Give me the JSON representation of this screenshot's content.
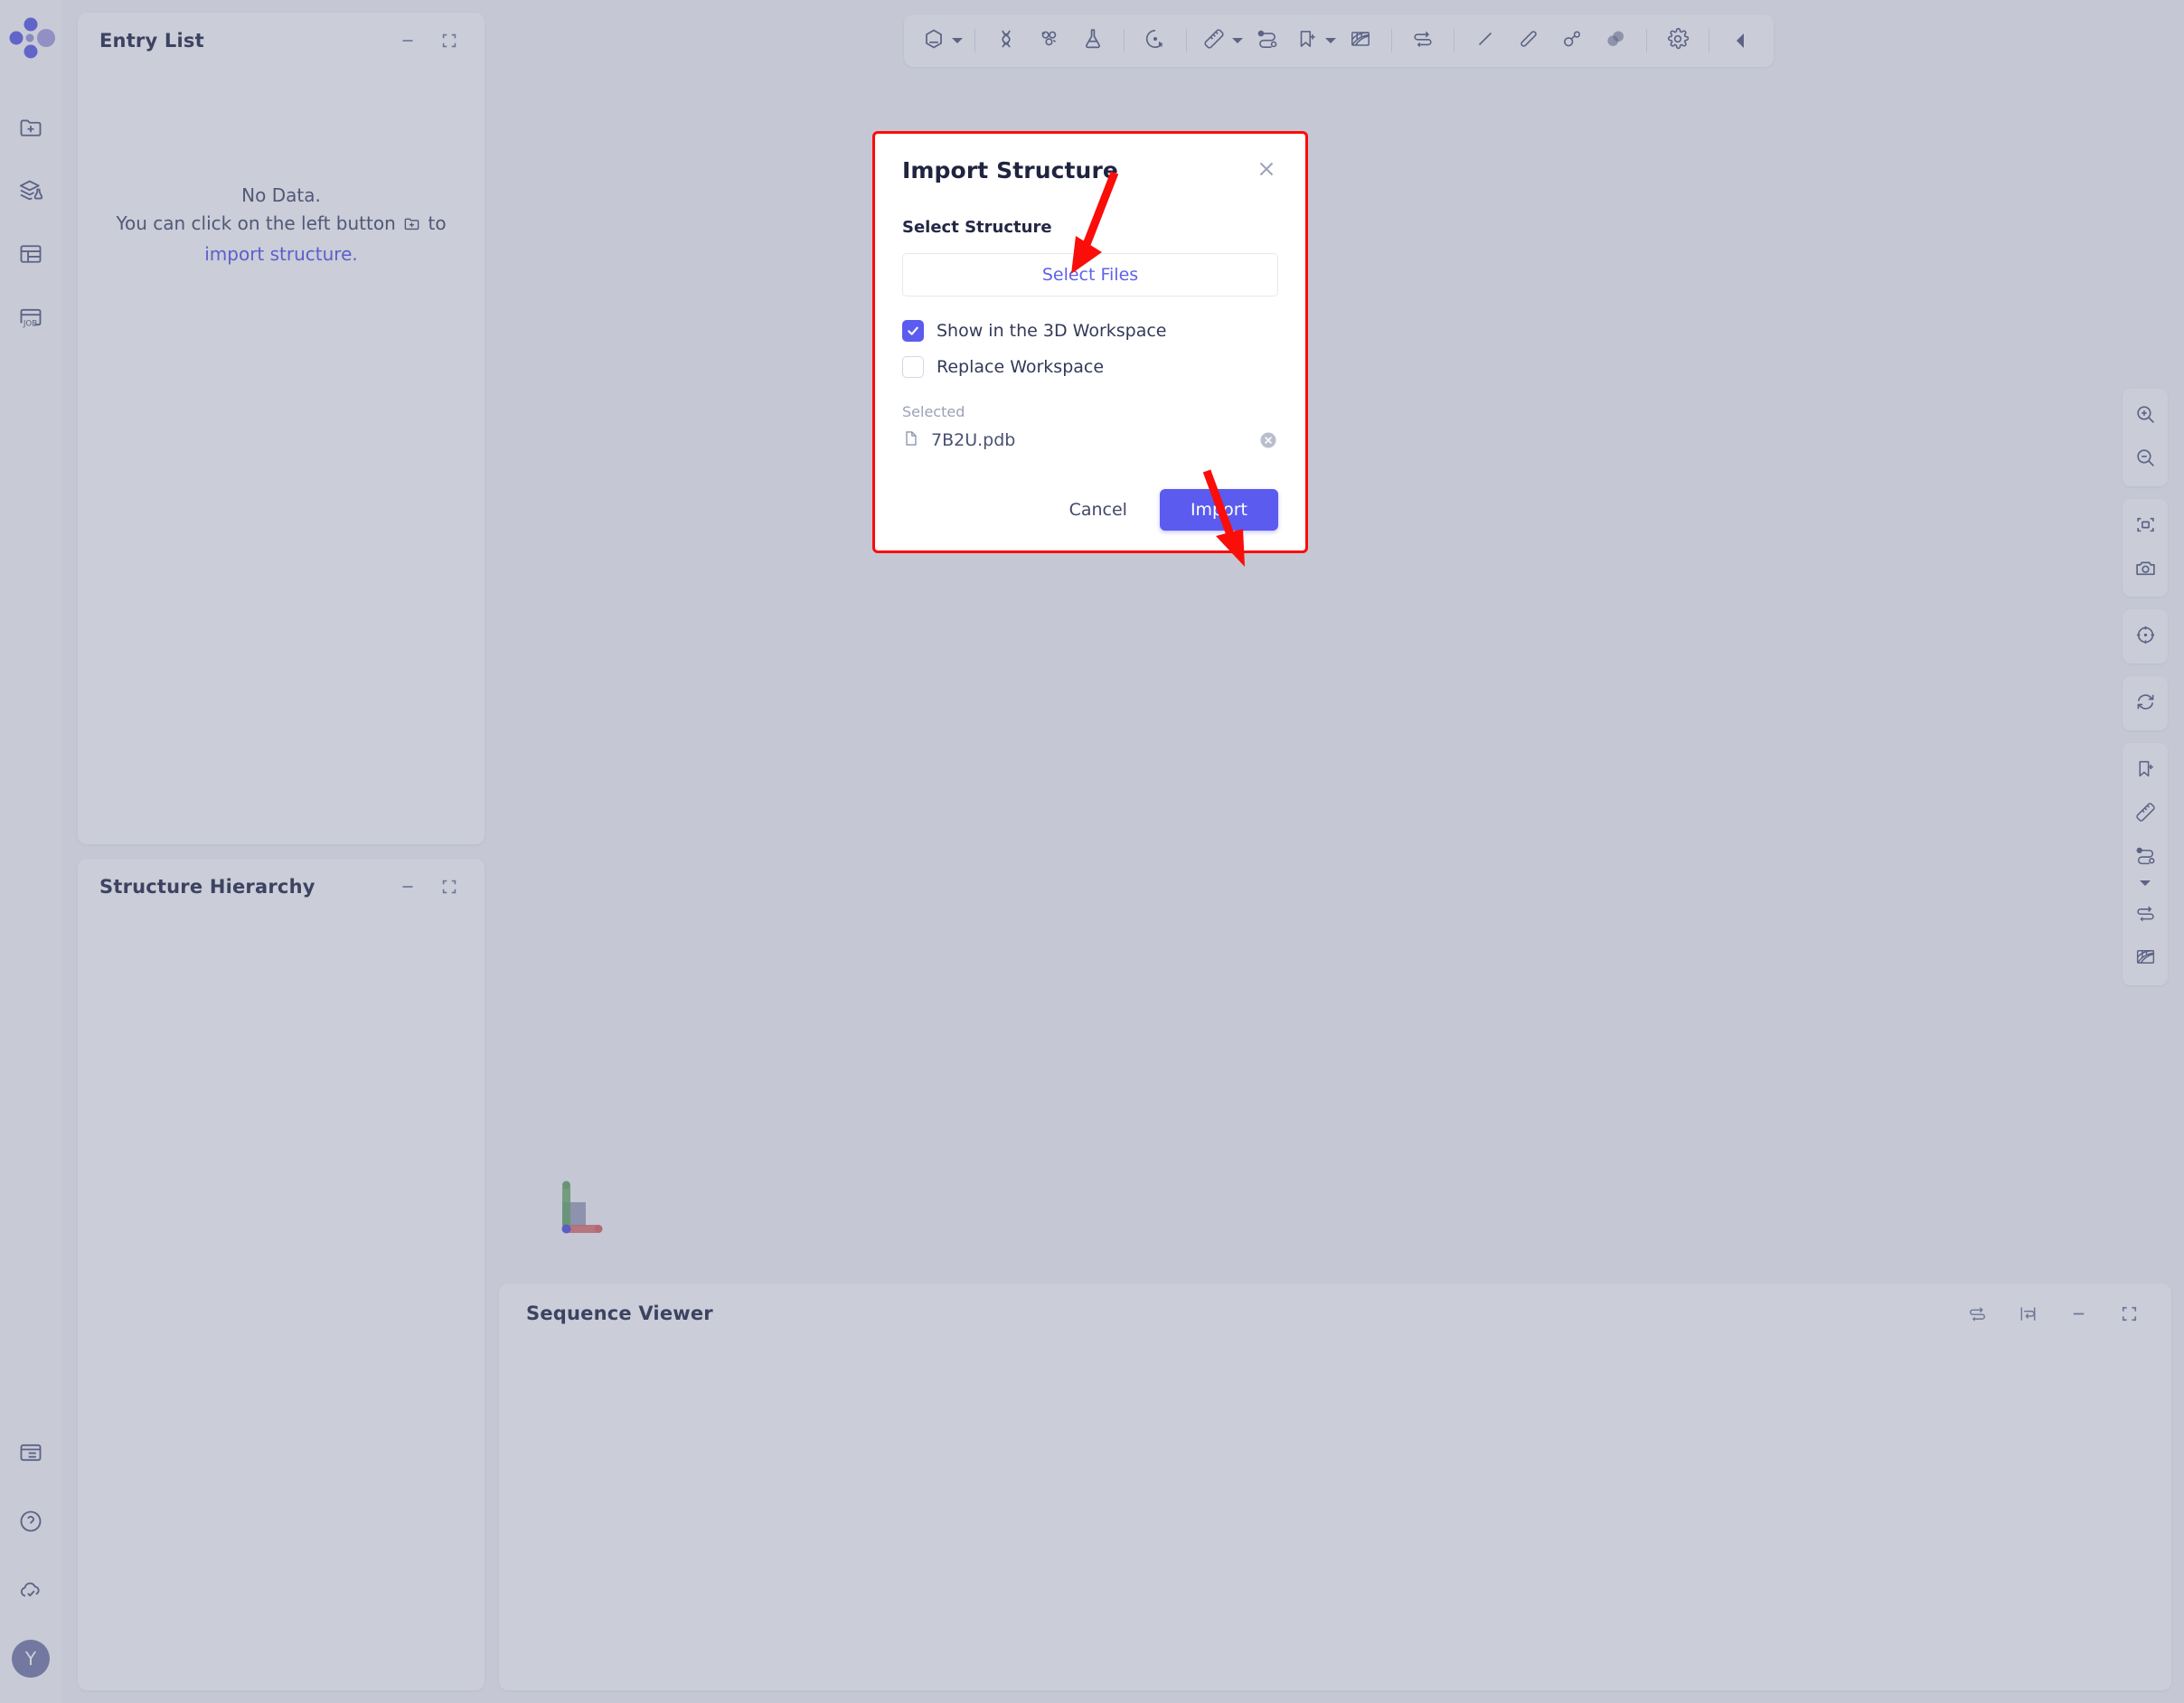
{
  "app": {
    "logo_icon": "molecule-dots-logo",
    "avatar_initial": "Y"
  },
  "rail": {
    "top_items": [
      {
        "name": "import-structure",
        "icon": "folder-plus-icon"
      },
      {
        "name": "structure-library",
        "icon": "layers-flask-icon"
      },
      {
        "name": "table-view",
        "icon": "table-layout-icon"
      },
      {
        "name": "jobs",
        "icon": "job-card-icon"
      }
    ],
    "bottom_items": [
      {
        "name": "log-panel",
        "icon": "list-window-icon"
      },
      {
        "name": "help",
        "icon": "question-circle-icon"
      },
      {
        "name": "cloud-sync",
        "icon": "cloud-check-icon"
      }
    ]
  },
  "panels": {
    "entry_list": {
      "title": "Entry List",
      "empty_line1": "No Data.",
      "empty_line2_pre": "You can click on the left button",
      "empty_line2_post": "to",
      "empty_link": "import structure.",
      "minimize_icon": "minimize-icon",
      "expand_icon": "expand-icon"
    },
    "structure_hierarchy": {
      "title": "Structure Hierarchy",
      "minimize_icon": "minimize-icon",
      "expand_icon": "expand-icon"
    },
    "sequence_viewer": {
      "title": "Sequence Viewer",
      "actions": [
        {
          "name": "toggle-chain-swap",
          "icon": "swap-arrows-icon"
        },
        {
          "name": "wrap-lines",
          "icon": "wrap-text-icon"
        },
        {
          "name": "minimize",
          "icon": "minimize-icon"
        },
        {
          "name": "expand",
          "icon": "expand-icon"
        }
      ]
    }
  },
  "toolbar": {
    "items": [
      {
        "name": "structure-style",
        "icon": "hexagon-icon",
        "caret": true
      },
      {
        "sep": true
      },
      {
        "name": "nucleic-acid",
        "icon": "dna-helix-icon",
        "caret": false
      },
      {
        "name": "small-molecule",
        "icon": "molecule-icon",
        "caret": false
      },
      {
        "name": "experiment",
        "icon": "flask-icon",
        "caret": false
      },
      {
        "sep": true
      },
      {
        "name": "selection-mode",
        "icon": "select-pointer-icon",
        "caret": false
      },
      {
        "sep": true
      },
      {
        "name": "measure",
        "icon": "ruler-icon",
        "caret": true
      },
      {
        "name": "connection-path",
        "icon": "path-link-icon",
        "caret": false
      },
      {
        "name": "label",
        "icon": "bookmark-plus-icon",
        "caret": true
      },
      {
        "name": "surface-mesh",
        "icon": "mesh-icon",
        "caret": false
      },
      {
        "sep": true
      },
      {
        "name": "superpose",
        "icon": "swap-arrows-icon",
        "caret": false
      },
      {
        "sep": true
      },
      {
        "name": "distance-line",
        "icon": "line-icon",
        "caret": false
      },
      {
        "name": "bond-stick",
        "icon": "stick-icon",
        "caret": false
      },
      {
        "name": "ball-and-stick",
        "icon": "ball-stick-icon",
        "caret": false
      },
      {
        "name": "spheres",
        "icon": "spheres-icon",
        "caret": false
      },
      {
        "sep": true
      },
      {
        "name": "settings",
        "icon": "gear-icon",
        "caret": false
      },
      {
        "sep": true
      },
      {
        "name": "collapse-toolbar",
        "icon": "collapse-left-icon",
        "caret": false
      }
    ]
  },
  "right_tools": {
    "groups": [
      {
        "items": [
          {
            "name": "zoom-in",
            "icon": "zoom-in-icon"
          },
          {
            "name": "zoom-out",
            "icon": "zoom-out-icon"
          }
        ]
      },
      {
        "items": [
          {
            "name": "fit-to-screen",
            "icon": "fit-screen-icon"
          },
          {
            "name": "screenshot",
            "icon": "camera-icon"
          }
        ]
      },
      {
        "items": [
          {
            "name": "center-view",
            "icon": "crosshair-icon"
          }
        ]
      },
      {
        "items": [
          {
            "name": "reset-view",
            "icon": "refresh-icon"
          }
        ]
      },
      {
        "items": [
          {
            "name": "add-label",
            "icon": "bookmark-plus-icon"
          },
          {
            "name": "measure",
            "icon": "ruler-icon"
          },
          {
            "name": "connection-path",
            "icon": "path-link-icon",
            "caret": true
          },
          {
            "name": "superpose",
            "icon": "swap-arrows-icon"
          },
          {
            "name": "surface-mesh",
            "icon": "mesh-icon"
          }
        ]
      }
    ]
  },
  "viewport": {
    "axis_gizmo": {
      "name": "axis-gizmo",
      "x_color": "#d96a6a",
      "y_color": "#6aab6a",
      "z_color": "#8f93b0"
    }
  },
  "modal": {
    "title": "Import Structure",
    "close_icon": "close-icon",
    "select_structure_label": "Select Structure",
    "select_files_label": "Select Files",
    "checkboxes": [
      {
        "name": "show-in-3d-workspace",
        "label": "Show in the 3D Workspace",
        "checked": true
      },
      {
        "name": "replace-workspace",
        "label": "Replace Workspace",
        "checked": false
      }
    ],
    "selected_label": "Selected",
    "selected_files": [
      {
        "name": "7B2U.pdb",
        "file_icon": "file-icon",
        "remove_icon": "remove-circle-icon"
      }
    ],
    "cancel_label": "Cancel",
    "import_label": "Import",
    "accent_color": "#5b5bf0",
    "highlight_border_color": "#fb0d09"
  },
  "annotations": {
    "arrow_color": "#fb0d09",
    "arrows": [
      {
        "name": "arrow-to-select-files",
        "target": "select-files"
      },
      {
        "name": "arrow-to-import-button",
        "target": "import-button"
      }
    ]
  }
}
